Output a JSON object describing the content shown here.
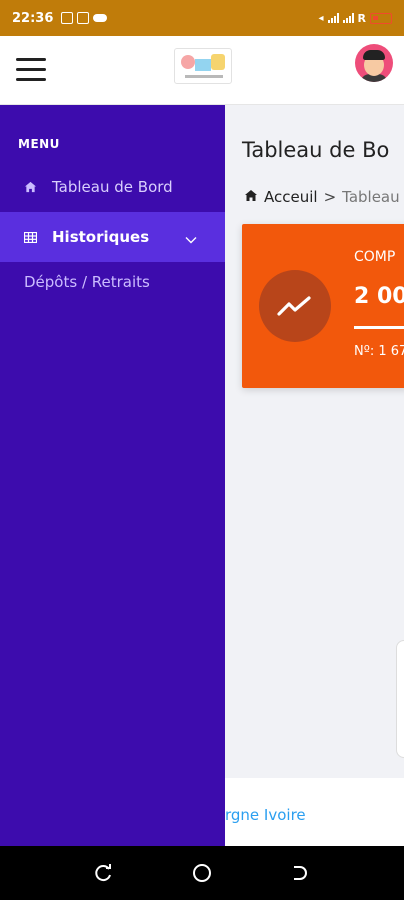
{
  "status_bar": {
    "time": "22:36",
    "carrier": "R"
  },
  "app_bar": {
    "logo": "logo"
  },
  "main": {
    "title": "Tableau de Bo",
    "breadcrumb": {
      "home": "Acceuil",
      "separator": ">",
      "current": "Tableau"
    },
    "card": {
      "label": "COMP",
      "value": "2 00",
      "number": "Nº: 1 67",
      "color": "#f2580c",
      "icon": "trending-up-icon"
    },
    "footer_text": "rgne Ivoire"
  },
  "drawer": {
    "heading": "MENU",
    "items": [
      {
        "label": "Tableau de Bord",
        "icon": "home-icon",
        "active": false
      },
      {
        "label": "Historiques",
        "icon": "table-icon",
        "active": true,
        "expanded": true
      }
    ],
    "sub_items": [
      {
        "label": "Dépôts / Retraits"
      }
    ],
    "background": "#3d0cad",
    "active_background": "#5a2fdf"
  },
  "colors": {
    "status_bar": "#c07c0a",
    "footer_link": "#2b9ff0"
  }
}
